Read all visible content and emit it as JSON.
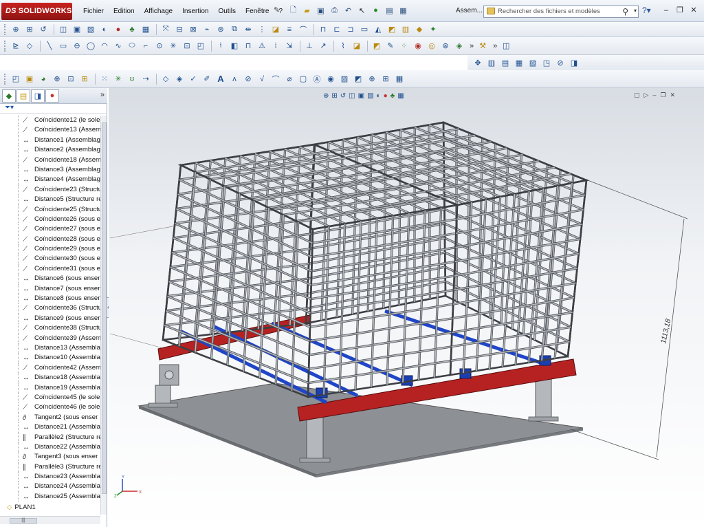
{
  "app": {
    "name": "SOLIDWORKS",
    "logo_prefix": "DS",
    "document_title": "Assem...",
    "colors": {
      "logo_red": "#b21d1a",
      "accent_blue": "#1f4f8f",
      "frame_gray": "#b5b9be",
      "beam_red": "#b62222",
      "beam_blue": "#1f45c8"
    }
  },
  "menu": [
    "Fichier",
    "Edition",
    "Affichage",
    "Insertion",
    "Outils",
    "Fenêtre",
    "?"
  ],
  "search": {
    "placeholder": "Rechercher des fichiers et modèles"
  },
  "help_icon": "question-icon",
  "window_controls": [
    "minimize-icon",
    "restore-icon",
    "close-icon"
  ],
  "feature_manager": {
    "tabs": [
      "feature-tree-icon",
      "property-icon",
      "config-icon",
      "appearance-icon"
    ],
    "filter_icon": "funnel-icon",
    "items": [
      {
        "icon": "coincident-icon",
        "label": "Coïncidente12 (le sole"
      },
      {
        "icon": "coincident-icon",
        "label": "Coïncidente13 (Assem"
      },
      {
        "icon": "distance-icon",
        "label": "Distance1 (Assemblag"
      },
      {
        "icon": "distance-icon",
        "label": "Distance2 (Assemblag"
      },
      {
        "icon": "coincident-icon",
        "label": "Coïncidente18 (Assem"
      },
      {
        "icon": "distance-icon",
        "label": "Distance3 (Assemblag"
      },
      {
        "icon": "distance-icon",
        "label": "Distance4 (Assemblag"
      },
      {
        "icon": "coincident-icon",
        "label": "Coïncidente23 (Structu"
      },
      {
        "icon": "distance-icon",
        "label": "Distance5 (Structure re"
      },
      {
        "icon": "coincident-icon",
        "label": "Coïncidente25 (Structu"
      },
      {
        "icon": "coincident-icon",
        "label": "Coïncidente26 (sous e"
      },
      {
        "icon": "coincident-icon",
        "label": "Coïncidente27 (sous e"
      },
      {
        "icon": "coincident-icon",
        "label": "Coïncidente28 (sous e"
      },
      {
        "icon": "coincident-icon",
        "label": "Coïncidente29 (sous e"
      },
      {
        "icon": "coincident-icon",
        "label": "Coïncidente30 (sous e"
      },
      {
        "icon": "coincident-icon",
        "label": "Coïncidente31 (sous e"
      },
      {
        "icon": "distance-icon",
        "label": "Distance6 (sous ensen"
      },
      {
        "icon": "distance-icon",
        "label": "Distance7 (sous ensen"
      },
      {
        "icon": "distance-icon",
        "label": "Distance8 (sous ensen"
      },
      {
        "icon": "coincident-icon",
        "label": "Coïncidente36 (Structu"
      },
      {
        "icon": "distance-icon",
        "label": "Distance9 (sous ensen"
      },
      {
        "icon": "coincident-icon",
        "label": "Coïncidente38 (Structu"
      },
      {
        "icon": "coincident-icon",
        "label": "Coïncidente39 (Assem"
      },
      {
        "icon": "distance-icon",
        "label": "Distance13 (Assembla"
      },
      {
        "icon": "distance-icon",
        "label": "Distance10 (Assembla"
      },
      {
        "icon": "coincident-icon",
        "label": "Coïncidente42 (Assem"
      },
      {
        "icon": "distance-icon",
        "label": "Distance18 (Assembla"
      },
      {
        "icon": "distance-icon",
        "label": "Distance19 (Assembla"
      },
      {
        "icon": "coincident-icon",
        "label": "Coïncidente45 (le sole"
      },
      {
        "icon": "coincident-icon",
        "label": "Coïncidente46 (le sole"
      },
      {
        "icon": "tangent-icon",
        "label": "Tangent2 (sous enser"
      },
      {
        "icon": "distance-icon",
        "label": "Distance21 (Assembla"
      },
      {
        "icon": "parallel-icon",
        "label": "Parallèle2 (Structure re"
      },
      {
        "icon": "distance-icon",
        "label": "Distance22 (Assembla"
      },
      {
        "icon": "tangent-icon",
        "label": "Tangent3 (sous enser"
      },
      {
        "icon": "parallel-icon",
        "label": "Parallèle3 (Structure re"
      },
      {
        "icon": "distance-icon",
        "label": "Distance23 (Assembla"
      },
      {
        "icon": "distance-icon",
        "label": "Distance24 (Assembla"
      },
      {
        "icon": "distance-icon",
        "label": "Distance25 (Assembla"
      }
    ],
    "plane": {
      "icon": "plane-icon",
      "label": "PLAN1"
    },
    "hscroll_glyph": "|||"
  },
  "viewport": {
    "dimension_value": "1113,18",
    "triad_labels": [
      "Y",
      "X",
      "Z"
    ]
  }
}
